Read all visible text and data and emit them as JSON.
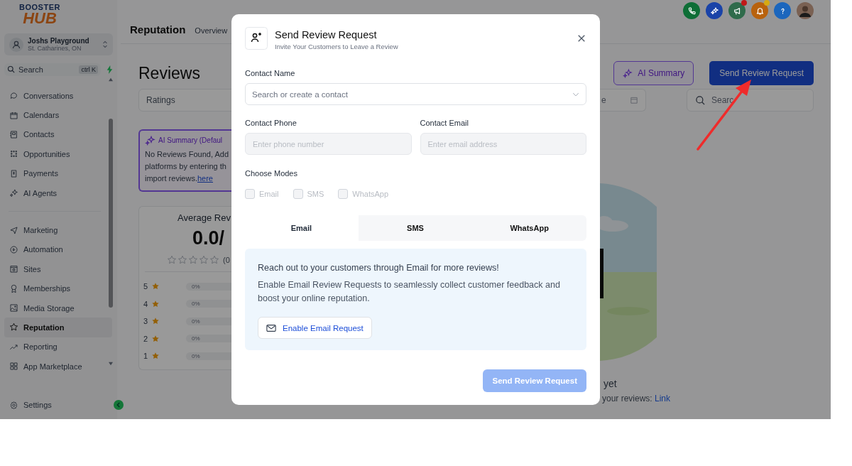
{
  "logo": {
    "top": "BOOSTER",
    "bottom": "HUB"
  },
  "account": {
    "name": "Joshs Playground",
    "location": "St. Catharines, ON"
  },
  "sidebar_search": {
    "placeholder": "Search",
    "shortcut": "ctrl K"
  },
  "sidebar_groups": [
    {
      "items": [
        {
          "label": "Conversations",
          "selected": false
        },
        {
          "label": "Calendars",
          "selected": false
        },
        {
          "label": "Contacts",
          "selected": false
        },
        {
          "label": "Opportunities",
          "selected": false
        },
        {
          "label": "Payments",
          "selected": false
        },
        {
          "label": "AI Agents",
          "selected": false
        }
      ]
    },
    {
      "items": [
        {
          "label": "Marketing",
          "selected": false
        },
        {
          "label": "Automation",
          "selected": false
        },
        {
          "label": "Sites",
          "selected": false
        },
        {
          "label": "Memberships",
          "selected": false
        },
        {
          "label": "Media Storage",
          "selected": false
        },
        {
          "label": "Reputation",
          "selected": true
        },
        {
          "label": "Reporting",
          "selected": false
        },
        {
          "label": "App Marketplace",
          "selected": false
        }
      ]
    }
  ],
  "sidebar_footer": {
    "label": "Settings"
  },
  "header": {
    "title": "Reputation",
    "link": "Overview"
  },
  "top_icons": [
    {
      "color": "#0e6e36"
    },
    {
      "color": "#1a43a8"
    },
    {
      "color": "#2f6b4b",
      "badge": {
        "color": "#c01818"
      }
    },
    {
      "color": "#b8620e",
      "badge": {
        "color": "#d6a914"
      }
    },
    {
      "color": "#1b66bd"
    }
  ],
  "page": {
    "title": "Reviews",
    "ai_summary_button": "AI Summary",
    "send_button": "Send Review Request",
    "ratings_filter": "Ratings",
    "date_filter": "e",
    "search": {
      "placeholder": "Searc"
    }
  },
  "ai_summary_card": {
    "title": "AI Summary (Defaul",
    "lines": [
      "No Reviews Found, Add",
      "platforms by entering th",
      "import reviews."
    ],
    "link": "here"
  },
  "rating_card": {
    "title": "Average Rev",
    "score": "0.0/",
    "stars": 0,
    "count": "(0",
    "bars": [
      {
        "label": "5",
        "percent": "0%"
      },
      {
        "label": "4",
        "percent": "0%"
      },
      {
        "label": "3",
        "percent": "0%"
      },
      {
        "label": "2",
        "percent": "0%"
      },
      {
        "label": "1",
        "percent": "0%"
      }
    ]
  },
  "empty_state": {
    "title": "yet",
    "text": "your reviews:",
    "link": "Link"
  },
  "modal": {
    "title": "Send Review Request",
    "subtitle": "Invite Your Customers to Leave a Review",
    "contact_name": {
      "label": "Contact Name",
      "placeholder": "Search or create a contact"
    },
    "contact_phone": {
      "label": "Contact Phone",
      "placeholder": "Enter phone number",
      "disabled": true
    },
    "contact_email": {
      "label": "Contact Email",
      "placeholder": "Enter email address",
      "disabled": true
    },
    "modes_label": "Choose Modes",
    "modes": [
      {
        "label": "Email",
        "checked": false,
        "disabled": true
      },
      {
        "label": "SMS",
        "checked": false,
        "disabled": true
      },
      {
        "label": "WhatsApp",
        "checked": false,
        "disabled": true
      }
    ],
    "tabs": [
      {
        "label": "Email",
        "selected": true
      },
      {
        "label": "SMS",
        "selected": false
      },
      {
        "label": "WhatsApp",
        "selected": false
      }
    ],
    "panel": {
      "heading": "Reach out to your customers through Email for more reviews!",
      "text": "Enable Email Review Requests to seamlessly collect customer feedback and boost your online reputation.",
      "button": "Enable Email Request"
    },
    "submit": {
      "label": "Send Review Request",
      "disabled": true
    }
  }
}
